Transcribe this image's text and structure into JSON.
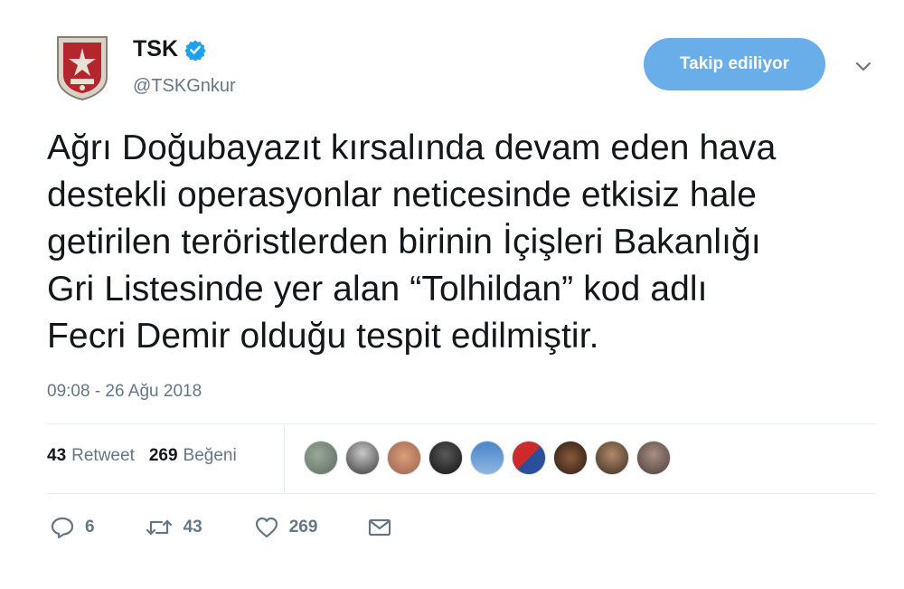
{
  "account": {
    "name": "TSK",
    "handle": "@TSKGnkur",
    "verified": true,
    "avatar_icon": "tsk-emblem-icon"
  },
  "follow_button": {
    "label": "Takip ediliyor",
    "color": "#6aaee9"
  },
  "menu": {
    "icon": "chevron-down-icon"
  },
  "tweet": {
    "lines": [
      "Ağrı Doğubayazıt kırsalında devam eden hava",
      "destekli operasyonlar neticesinde etkisiz hale",
      "getirilen teröristlerden birinin İçişleri Bakanlığı",
      "Gri Listesinde yer alan “Tolhildan” kod adlı",
      "Fecri Demir olduğu tespit edilmiştir."
    ],
    "timestamp": "09:08 - 26 Ağu 2018"
  },
  "stats": {
    "retweets": {
      "count": "43",
      "label": "Retweet"
    },
    "likes": {
      "count": "269",
      "label": "Beğeni"
    }
  },
  "likers_count": 9,
  "actions": {
    "reply": {
      "icon": "reply-icon",
      "count": "6"
    },
    "retweet": {
      "icon": "retweet-icon",
      "count": "43"
    },
    "like": {
      "icon": "heart-icon",
      "count": "269"
    },
    "dm": {
      "icon": "envelope-icon"
    }
  },
  "colors": {
    "secondary_text": "#657786",
    "verified_blue": "#1da1f2",
    "divider": "#e6ecf0"
  }
}
